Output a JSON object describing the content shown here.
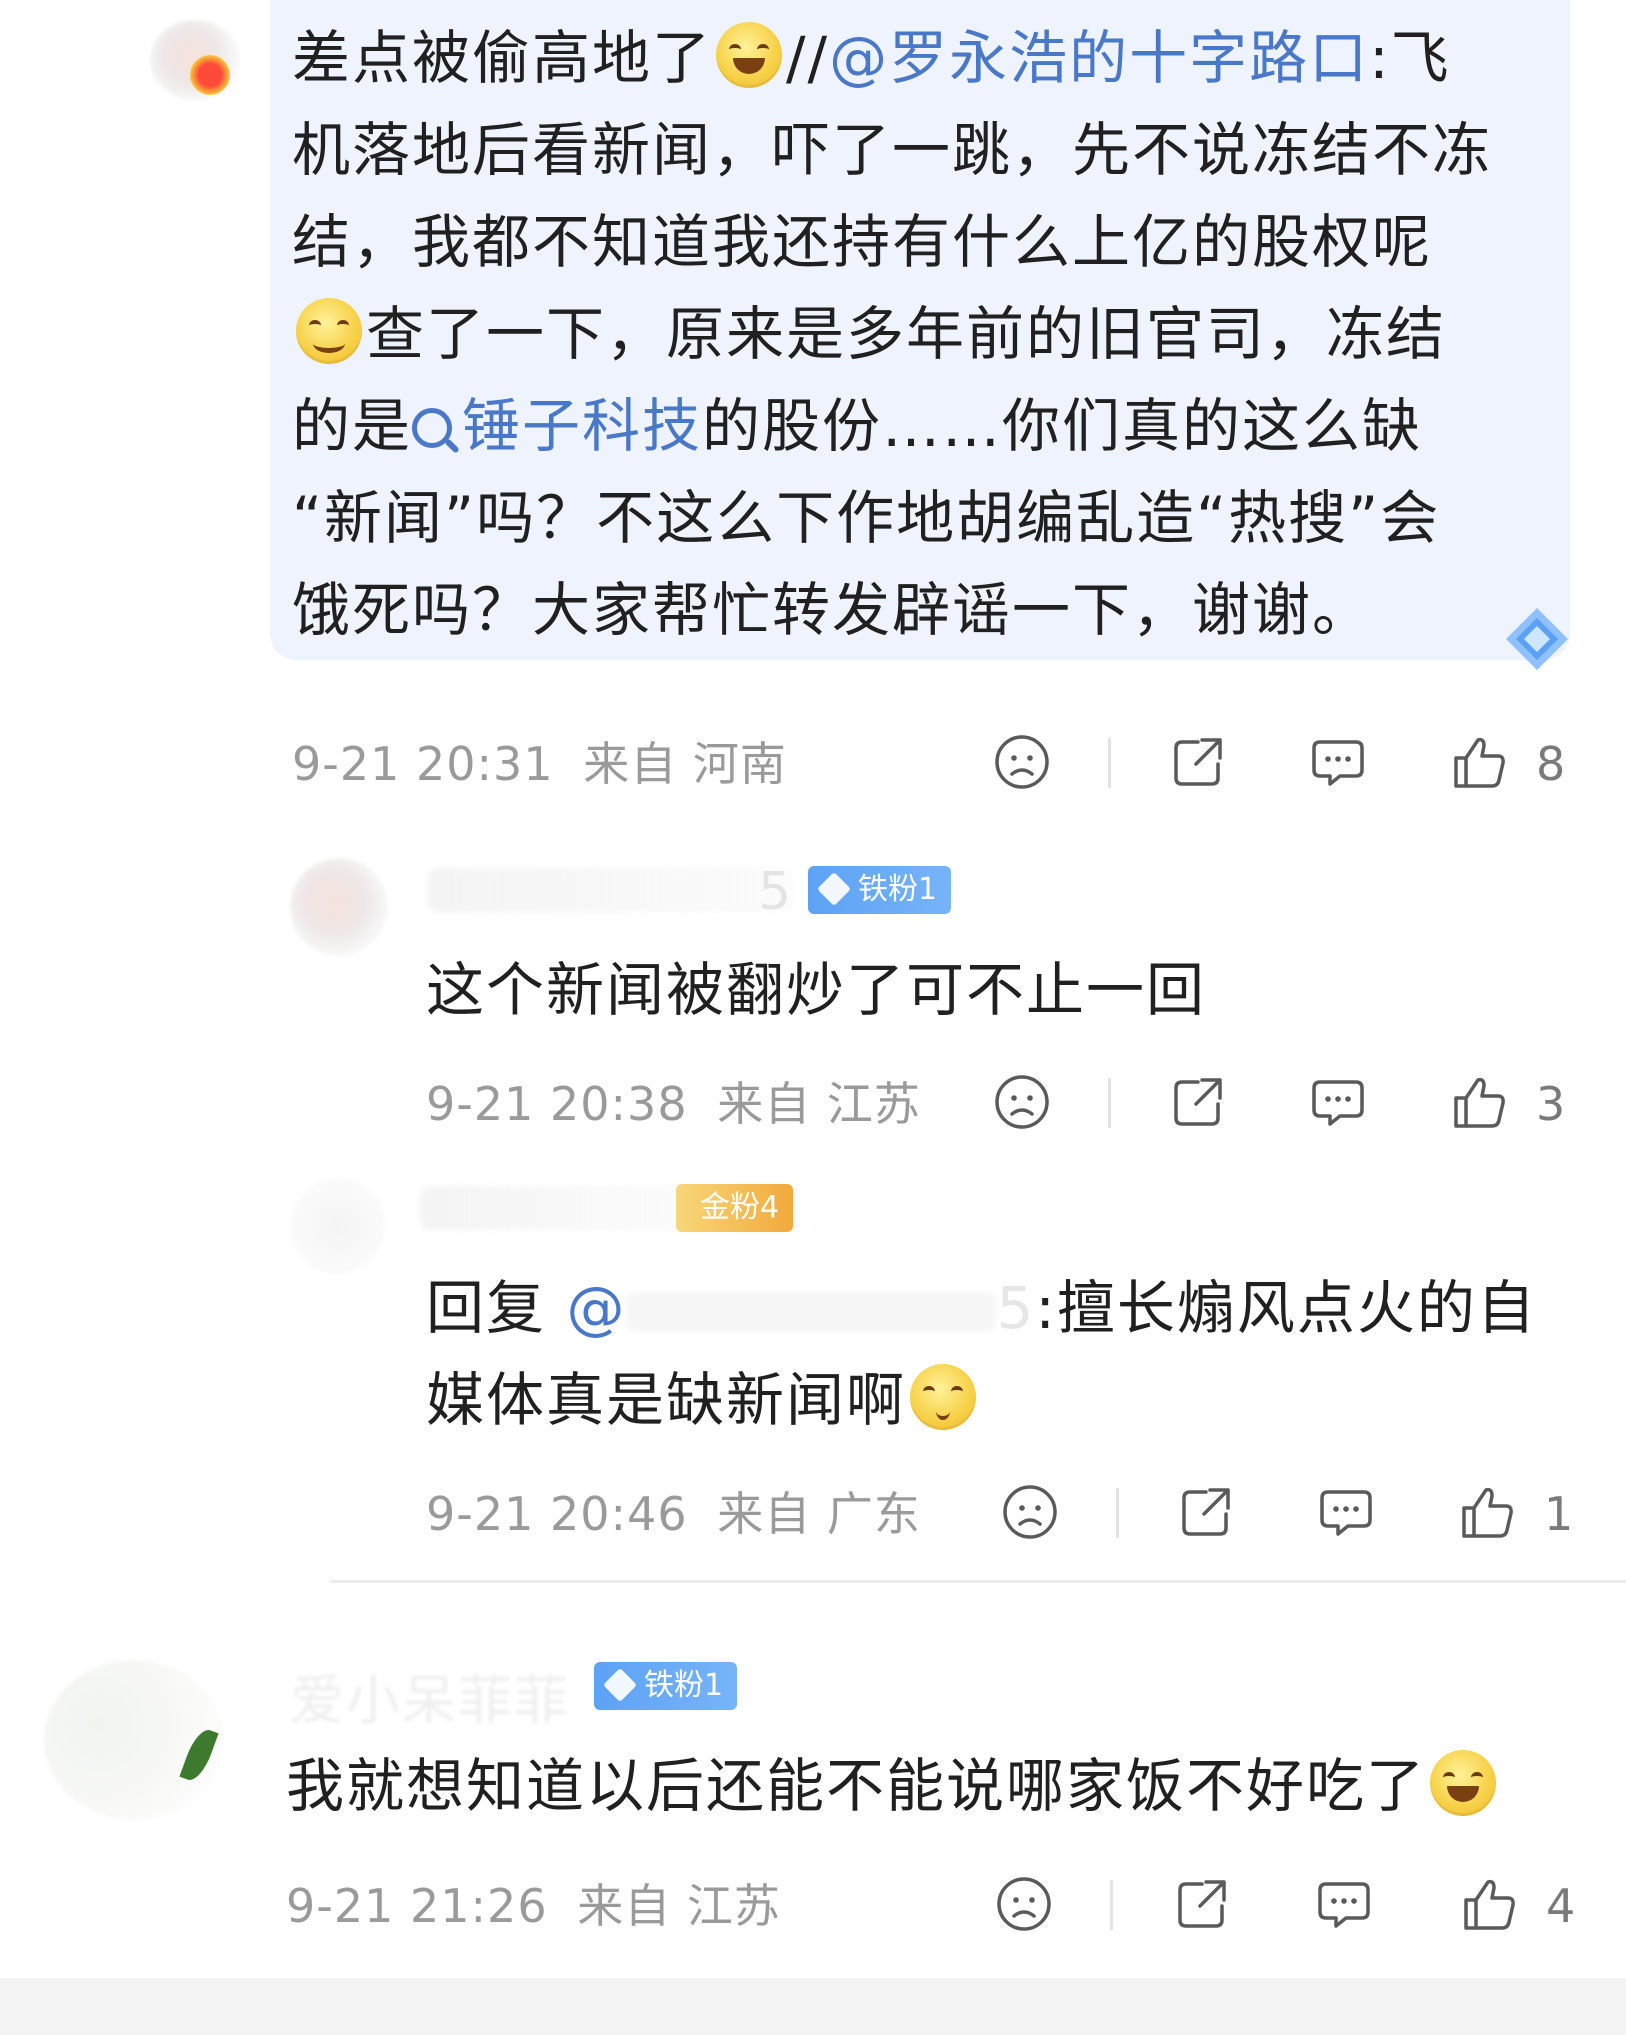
{
  "comments": [
    {
      "text_a": "差点被偷高地了",
      "emoji_a": "laughing-tears-emoji",
      "text_b": "//",
      "mention": "@罗永浩的十字路口",
      "text_c": ":飞",
      "line2": "机落地后看新闻，吓了一跳，先不说冻结不冻",
      "line3": "结，我都不知道我还持有什么上亿的股权呢",
      "emoji_b": "smiling-blush-emoji",
      "line4": "查了一下，原来是多年前的旧官司，冻结",
      "line5_a": "的是",
      "topic": "锤子科技",
      "line5_b": "的股份……你们真的这么缺",
      "line6": "“新闻”吗？不这么下作地胡编乱造“热搜”会",
      "line7": "饿死吗？大家帮忙转发辟谣一下，谢谢。",
      "time": "9-21 20:31",
      "from": "来自 河南",
      "likes": "8"
    },
    {
      "name_tail": "5",
      "badge": "铁粉1",
      "text": "这个新闻被翻炒了可不止一回",
      "time": "9-21 20:38",
      "from": "来自 江苏",
      "likes": "3"
    },
    {
      "badge": "金粉4",
      "reply_prefix": "回复",
      "reply_at": "@",
      "reply_name_tail": "5",
      "line1": ":擅长煽风点火的自",
      "line2": "媒体真是缺新闻啊",
      "emoji": "shushing-emoji",
      "time": "9-21 20:46",
      "from": "来自 广东",
      "likes": "1"
    },
    {
      "name_partial": "爱小呆菲菲",
      "badge": "铁粉1",
      "text": "我就想知道以后还能不能说哪家饭不好吃了",
      "emoji": "laughing-crying-emoji",
      "time": "9-21 21:26",
      "from": "来自 江苏",
      "likes": "4"
    }
  ],
  "colors": {
    "link": "#4a78c8",
    "meta": "#9a9a9a",
    "highlight_bg": "#eef3fd",
    "iron_badge": "#5da2f5",
    "gold_badge": "#f2a93b"
  }
}
